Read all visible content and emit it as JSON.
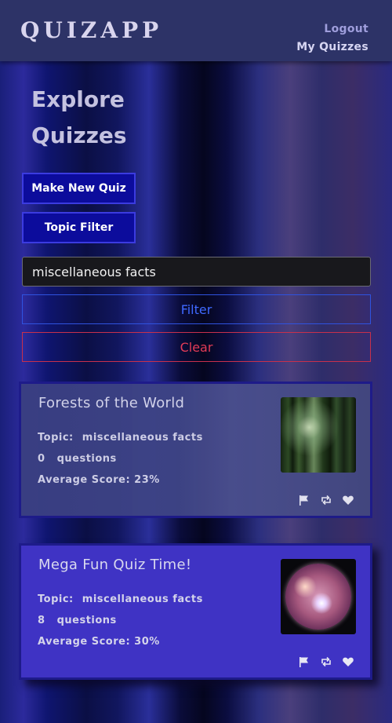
{
  "header": {
    "logo": "QUIZAPP",
    "logout_label": "Logout",
    "my_quizzes_label": "My Quizzes"
  },
  "page": {
    "title": "Explore Quizzes"
  },
  "actions": {
    "make_new_quiz_label": "Make New Quiz",
    "topic_filter_label": "Topic Filter"
  },
  "filter": {
    "search_value": "miscellaneous facts",
    "filter_label": "Filter",
    "clear_label": "Clear"
  },
  "quizzes": [
    {
      "title": "Forests of the World",
      "topic_label": "Topic:",
      "topic": "miscellaneous facts",
      "question_count": "0",
      "questions_label": "questions",
      "average_score_label": "Average Score: 23%",
      "image": "forest-photo"
    },
    {
      "title": "Mega Fun Quiz Time!",
      "topic_label": "Topic:",
      "topic": "miscellaneous facts",
      "question_count": "8",
      "questions_label": "questions",
      "average_score_label": "Average Score: 30%",
      "image": "sun-photo"
    }
  ],
  "card_icons": [
    "flag-icon",
    "retweet-icon",
    "heart-icon"
  ],
  "colors": {
    "header_bg": "#2d3367",
    "primary_button": "#0c0c9c",
    "filter_accent": "#3f69ff",
    "clear_accent": "#e23b57",
    "card_highlight": "#3f33c4"
  }
}
